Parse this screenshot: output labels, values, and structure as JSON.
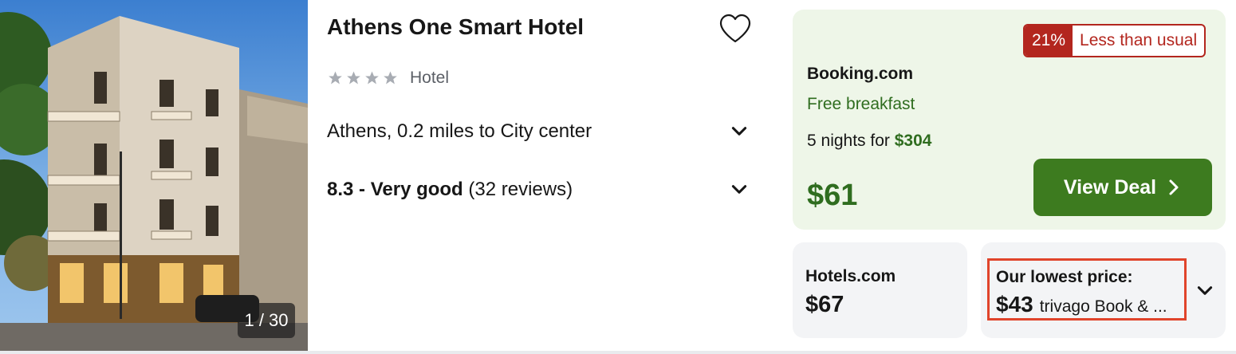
{
  "hotel": {
    "name": "Athens One Smart Hotel",
    "star_count": 4,
    "type": "Hotel",
    "location": "Athens, 0.2 miles to City center",
    "rating_score": "8.3 - Very good",
    "rating_reviews": "(32 reviews)"
  },
  "photo": {
    "counter": "1 / 30"
  },
  "deal": {
    "badge_percent": "21%",
    "badge_text": "Less than usual",
    "provider": "Booking.com",
    "perk": "Free breakfast",
    "nights_prefix": "5 nights for ",
    "nights_total": "$304",
    "price": "$61",
    "button_label": "View Deal"
  },
  "alt_deals": {
    "hotels_name": "Hotels.com",
    "hotels_price": "$67",
    "lowest_label": "Our lowest price:",
    "lowest_price": "$43",
    "lowest_source": "trivago Book & ..."
  },
  "colors": {
    "deal_green": "#2f6d1f",
    "button_green": "#3d7b1f",
    "badge_red": "#b3261e",
    "deal_bg": "#eef6e8",
    "highlight_border": "#e0442b"
  },
  "icons": {
    "favorite": "heart-outline-icon",
    "expand": "chevron-down-icon",
    "deal_arrow": "chevron-right-icon",
    "stars": "star-icon"
  }
}
